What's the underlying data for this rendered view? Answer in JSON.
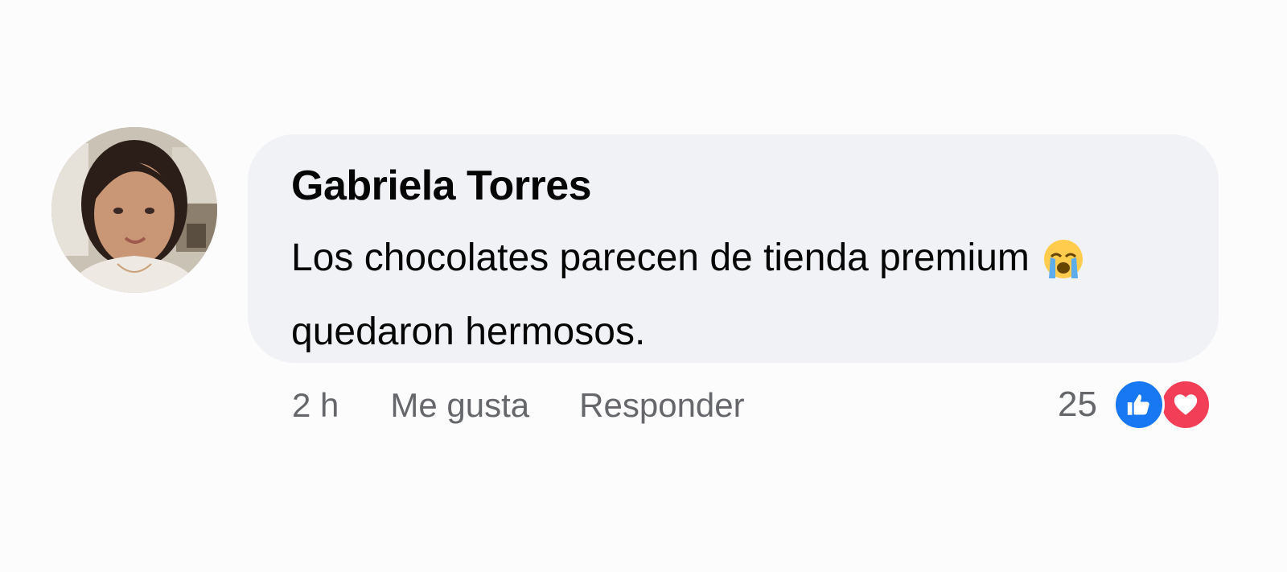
{
  "comment": {
    "author": "Gabriela Torres",
    "text": "Los chocolates parecen de tienda premium",
    "text_continued": "quedaron hermosos.",
    "emoji": "loudly-crying-face-icon",
    "timestamp": "2 h",
    "like_label": "Me gusta",
    "reply_label": "Responder",
    "reaction_count": "25",
    "reactions": [
      "like-icon",
      "love-icon"
    ]
  },
  "colors": {
    "bubble": "#f1f2f5",
    "meta_text": "#65676b",
    "like_blue": "#1877f2",
    "love_red": "#f33e58"
  }
}
